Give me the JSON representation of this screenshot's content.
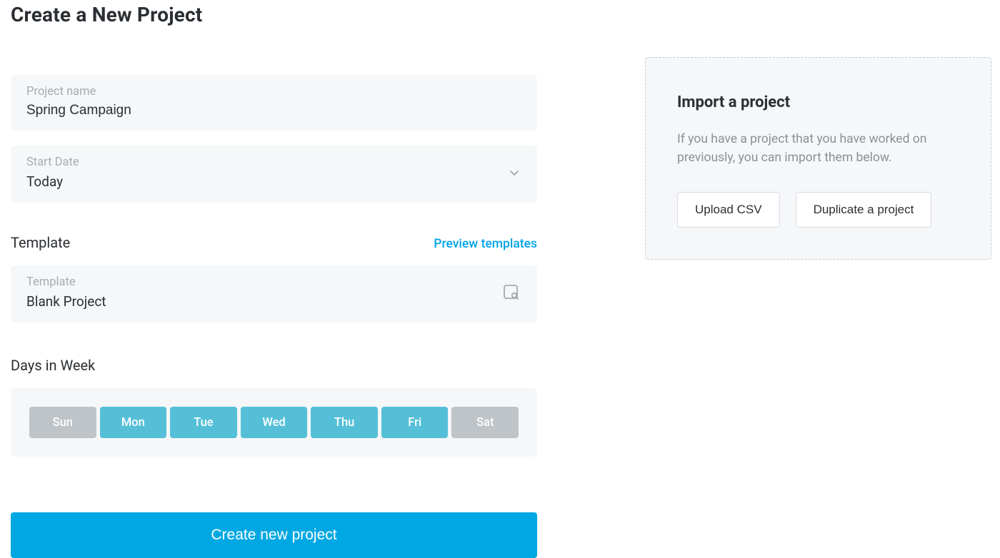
{
  "page_title": "Create a New Project",
  "project_name": {
    "label": "Project name",
    "value": "Spring Campaign"
  },
  "start_date": {
    "label": "Start Date",
    "value": "Today"
  },
  "template_section": {
    "heading": "Template",
    "preview_link": "Preview templates"
  },
  "template_field": {
    "label": "Template",
    "value": "Blank Project"
  },
  "days_section_heading": "Days in Week",
  "days": [
    {
      "label": "Sun",
      "active": false
    },
    {
      "label": "Mon",
      "active": true
    },
    {
      "label": "Tue",
      "active": true
    },
    {
      "label": "Wed",
      "active": true
    },
    {
      "label": "Thu",
      "active": true
    },
    {
      "label": "Fri",
      "active": true
    },
    {
      "label": "Sat",
      "active": false
    }
  ],
  "create_button_label": "Create new project",
  "import": {
    "heading": "Import a project",
    "description": "If you have a project that you have worked on previously, you can import them below.",
    "upload_label": "Upload CSV",
    "duplicate_label": "Duplicate a project"
  },
  "colors": {
    "accent": "#00a8e3",
    "day_active": "#55bfd8",
    "day_inactive": "#bfc4c9",
    "card_bg": "#f5f7f9"
  }
}
